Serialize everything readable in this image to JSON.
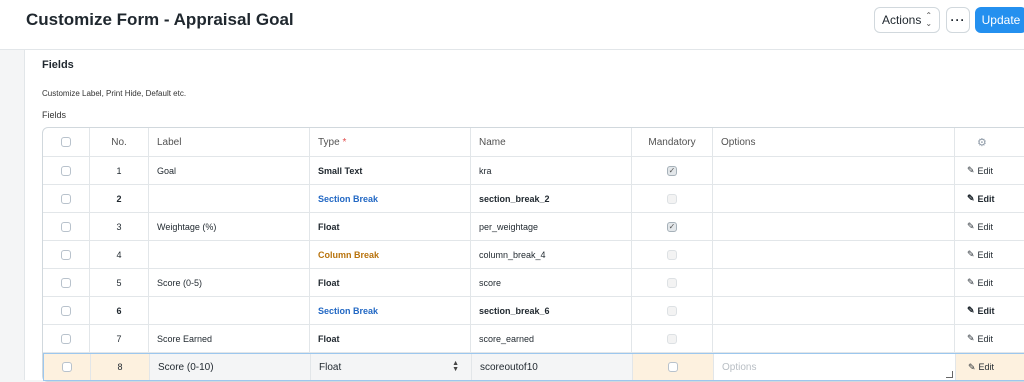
{
  "page": {
    "title": "Customize Form - Appraisal Goal",
    "actions_label": "Actions",
    "more_label": "···",
    "update_label": "Update"
  },
  "section": {
    "title": "Fields",
    "description": "Customize Label, Print Hide, Default etc.",
    "fields_label": "Fields"
  },
  "table": {
    "headers": {
      "no": "No.",
      "label": "Label",
      "type": "Type",
      "type_required_mark": "*",
      "name": "Name",
      "mandatory": "Mandatory",
      "options": "Options"
    },
    "edit_label": "Edit",
    "rows": [
      {
        "no": "1",
        "label": "Goal",
        "type": "Small Text",
        "name": "kra",
        "mandatory": true
      },
      {
        "no": "2",
        "label": "",
        "type": "Section Break",
        "name": "section_break_2",
        "mandatory": false
      },
      {
        "no": "3",
        "label": "Weightage (%)",
        "type": "Float",
        "name": "per_weightage",
        "mandatory": true
      },
      {
        "no": "4",
        "label": "",
        "type": "Column Break",
        "name": "column_break_4",
        "mandatory": false
      },
      {
        "no": "5",
        "label": "Score (0-5)",
        "type": "Float",
        "name": "score",
        "mandatory": false
      },
      {
        "no": "6",
        "label": "",
        "type": "Section Break",
        "name": "section_break_6",
        "mandatory": false
      },
      {
        "no": "7",
        "label": "Score Earned",
        "type": "Float",
        "name": "score_earned",
        "mandatory": false
      },
      {
        "no": "8",
        "label": "Score (0-10)",
        "type": "Float",
        "name": "scoreoutof10",
        "mandatory": false,
        "options_placeholder": "Options"
      }
    ]
  },
  "colors": {
    "primary": "#2490ef",
    "section_break": "#2268c4",
    "column_break": "#b8730d",
    "active_row_highlight": "#fdf1df"
  },
  "icons": {
    "gear": "gear-icon",
    "pencil": "pencil-icon",
    "chevron": "chevron-updown-icon"
  }
}
